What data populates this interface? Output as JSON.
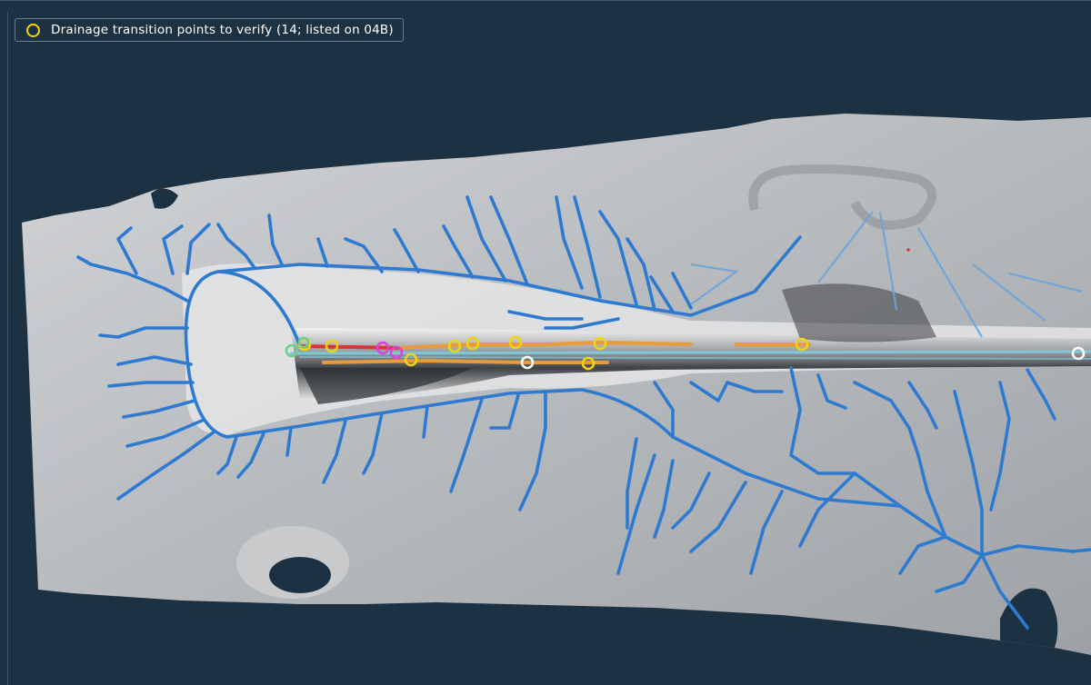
{
  "legend": {
    "items": [
      {
        "label": "Drainage transition points to verify (14; listed on 04B)",
        "marker": "ring",
        "color": "#f0d40e"
      }
    ]
  },
  "colors": {
    "background": "#1c3142",
    "drainage_major": "#2e7ad0",
    "drainage_minor": "#6aa4d8",
    "corridor_red": "#d8343c",
    "corridor_orange": "#e99a3a",
    "corridor_cyan": "#7cc8d8",
    "transition_yellow": "#f0d40e",
    "marker_white": "#ffffff",
    "marker_green": "#6cd08a",
    "marker_magenta": "#e040d8"
  },
  "markers": {
    "transition_point_count": 14,
    "icons": [
      "yellow-ring",
      "white-ring",
      "green-ring",
      "magenta-ring"
    ]
  }
}
